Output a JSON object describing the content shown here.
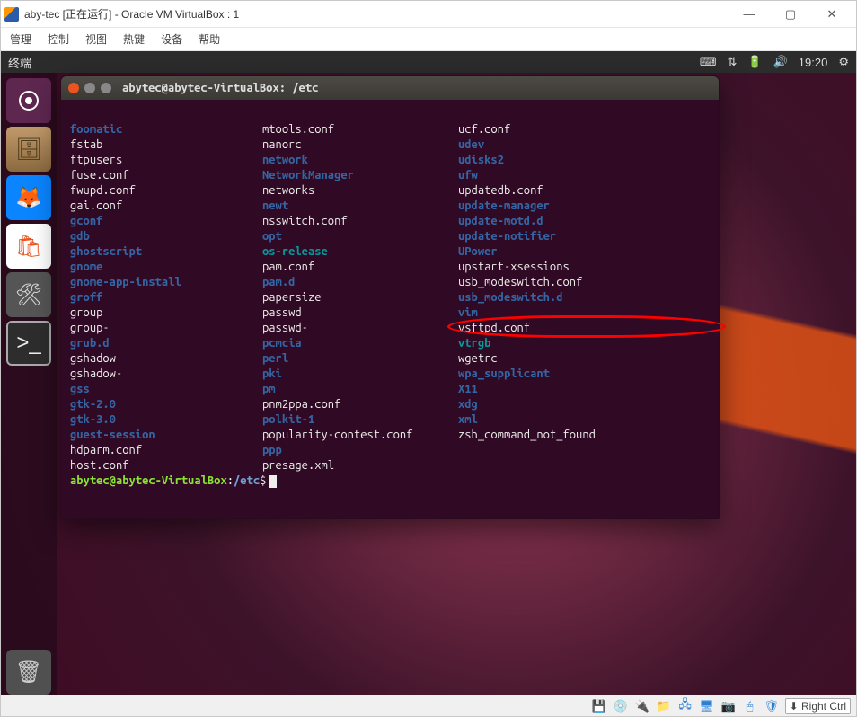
{
  "vbox": {
    "title": "aby-tec [正在运行] - Oracle VM VirtualBox : 1",
    "menus": [
      "管理",
      "控制",
      "视图",
      "热键",
      "设备",
      "帮助"
    ],
    "status_icons": [
      "hdd-icon",
      "cd-icon",
      "usb-icon",
      "folder-icon",
      "net-icon",
      "display-icon",
      "camera-icon",
      "mouse-icon",
      "shield-icon"
    ],
    "hostkey": "Right Ctrl"
  },
  "gnome_panel": {
    "title": "终端",
    "clock": "19:20",
    "icons": [
      "keyboard-icon",
      "network-icon",
      "battery-icon",
      "volume-icon",
      "gear-icon"
    ]
  },
  "launcher": {
    "items": [
      {
        "name": "dash-icon",
        "glyph": "◌"
      },
      {
        "name": "files-icon",
        "glyph": "🗄"
      },
      {
        "name": "firefox-icon",
        "glyph": "🦊"
      },
      {
        "name": "software-icon",
        "glyph": "A"
      },
      {
        "name": "settings-icon",
        "glyph": "⚙"
      },
      {
        "name": "terminal-icon",
        "glyph": ">_"
      }
    ],
    "trash": {
      "name": "trash-icon",
      "glyph": "🗑"
    }
  },
  "terminal": {
    "title": "abytec@abytec-VirtualBox: /etc",
    "listing": [
      {
        "c1": {
          "t": "foomatic",
          "k": "dir"
        },
        "c2": {
          "t": "mtools.conf",
          "k": "file"
        },
        "c3": {
          "t": "ucf.conf",
          "k": "file"
        }
      },
      {
        "c1": {
          "t": "fstab",
          "k": "file"
        },
        "c2": {
          "t": "nanorc",
          "k": "file"
        },
        "c3": {
          "t": "udev",
          "k": "dir"
        }
      },
      {
        "c1": {
          "t": "ftpusers",
          "k": "file"
        },
        "c2": {
          "t": "network",
          "k": "dir"
        },
        "c3": {
          "t": "udisks2",
          "k": "dir"
        }
      },
      {
        "c1": {
          "t": "fuse.conf",
          "k": "file"
        },
        "c2": {
          "t": "NetworkManager",
          "k": "dir"
        },
        "c3": {
          "t": "ufw",
          "k": "dir"
        }
      },
      {
        "c1": {
          "t": "fwupd.conf",
          "k": "file"
        },
        "c2": {
          "t": "networks",
          "k": "file"
        },
        "c3": {
          "t": "updatedb.conf",
          "k": "file"
        }
      },
      {
        "c1": {
          "t": "gai.conf",
          "k": "file"
        },
        "c2": {
          "t": "newt",
          "k": "dir"
        },
        "c3": {
          "t": "update-manager",
          "k": "dir"
        }
      },
      {
        "c1": {
          "t": "gconf",
          "k": "dir"
        },
        "c2": {
          "t": "nsswitch.conf",
          "k": "file"
        },
        "c3": {
          "t": "update-motd.d",
          "k": "dir"
        }
      },
      {
        "c1": {
          "t": "gdb",
          "k": "dir"
        },
        "c2": {
          "t": "opt",
          "k": "dir"
        },
        "c3": {
          "t": "update-notifier",
          "k": "dir"
        }
      },
      {
        "c1": {
          "t": "ghostscript",
          "k": "dir"
        },
        "c2": {
          "t": "os-release",
          "k": "link"
        },
        "c3": {
          "t": "UPower",
          "k": "dir"
        }
      },
      {
        "c1": {
          "t": "gnome",
          "k": "dir"
        },
        "c2": {
          "t": "pam.conf",
          "k": "file"
        },
        "c3": {
          "t": "upstart-xsessions",
          "k": "file"
        }
      },
      {
        "c1": {
          "t": "gnome-app-install",
          "k": "dir"
        },
        "c2": {
          "t": "pam.d",
          "k": "dir"
        },
        "c3": {
          "t": "usb_modeswitch.conf",
          "k": "file"
        }
      },
      {
        "c1": {
          "t": "groff",
          "k": "dir"
        },
        "c2": {
          "t": "papersize",
          "k": "file"
        },
        "c3": {
          "t": "usb_modeswitch.d",
          "k": "dir"
        }
      },
      {
        "c1": {
          "t": "group",
          "k": "file"
        },
        "c2": {
          "t": "passwd",
          "k": "file"
        },
        "c3": {
          "t": "vim",
          "k": "dir"
        }
      },
      {
        "c1": {
          "t": "group-",
          "k": "file"
        },
        "c2": {
          "t": "passwd-",
          "k": "file"
        },
        "c3": {
          "t": "vsftpd.conf",
          "k": "file",
          "annot": true
        }
      },
      {
        "c1": {
          "t": "grub.d",
          "k": "dir"
        },
        "c2": {
          "t": "pcmcia",
          "k": "dir"
        },
        "c3": {
          "t": "vtrgb",
          "k": "link"
        }
      },
      {
        "c1": {
          "t": "gshadow",
          "k": "file"
        },
        "c2": {
          "t": "perl",
          "k": "dir"
        },
        "c3": {
          "t": "wgetrc",
          "k": "file"
        }
      },
      {
        "c1": {
          "t": "gshadow-",
          "k": "file"
        },
        "c2": {
          "t": "pki",
          "k": "dir"
        },
        "c3": {
          "t": "wpa_supplicant",
          "k": "dir"
        }
      },
      {
        "c1": {
          "t": "gss",
          "k": "dir"
        },
        "c2": {
          "t": "pm",
          "k": "dir"
        },
        "c3": {
          "t": "X11",
          "k": "dir"
        }
      },
      {
        "c1": {
          "t": "gtk-2.0",
          "k": "dir"
        },
        "c2": {
          "t": "pnm2ppa.conf",
          "k": "file"
        },
        "c3": {
          "t": "xdg",
          "k": "dir"
        }
      },
      {
        "c1": {
          "t": "gtk-3.0",
          "k": "dir"
        },
        "c2": {
          "t": "polkit-1",
          "k": "dir"
        },
        "c3": {
          "t": "xml",
          "k": "dir"
        }
      },
      {
        "c1": {
          "t": "guest-session",
          "k": "dir"
        },
        "c2": {
          "t": "popularity-contest.conf",
          "k": "file"
        },
        "c3": {
          "t": "zsh_command_not_found",
          "k": "file"
        }
      },
      {
        "c1": {
          "t": "hdparm.conf",
          "k": "file"
        },
        "c2": {
          "t": "ppp",
          "k": "dir"
        },
        "c3": {
          "t": "",
          "k": "file"
        }
      },
      {
        "c1": {
          "t": "host.conf",
          "k": "file"
        },
        "c2": {
          "t": "presage.xml",
          "k": "file"
        },
        "c3": {
          "t": "",
          "k": "file"
        }
      }
    ],
    "prompt_user": "abytec@abytec-VirtualBox",
    "prompt_path": "/etc",
    "prompt_suffix": "$"
  }
}
